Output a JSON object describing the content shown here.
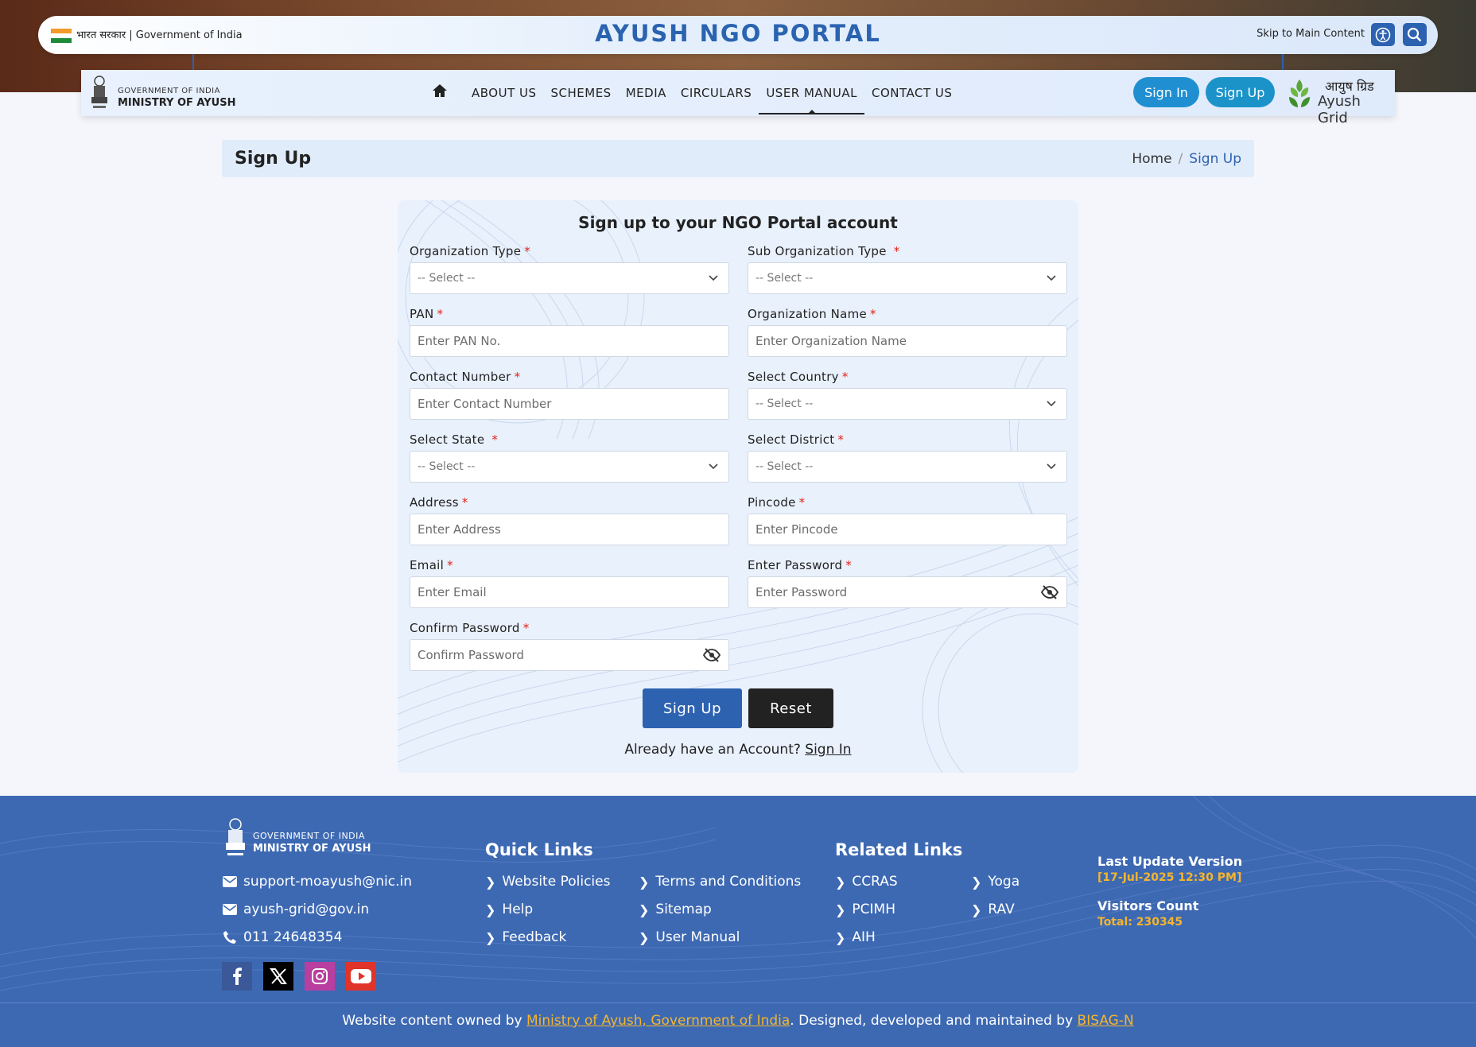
{
  "topbar": {
    "gov_label": "भारत सरकार | Government of India",
    "portal_title": "AYUSH NGO PORTAL",
    "skip_link": "Skip to Main Content",
    "accessibility_icon": "accessibility-icon",
    "search_icon": "search-icon"
  },
  "navbar": {
    "ministry_line1": "GOVERNMENT OF INDIA",
    "ministry_line2": "MINISTRY OF AYUSH",
    "home_icon": "home-icon",
    "menu": [
      {
        "label": "ABOUT US"
      },
      {
        "label": "SCHEMES"
      },
      {
        "label": "MEDIA"
      },
      {
        "label": "CIRCULARS"
      },
      {
        "label": "USER MANUAL",
        "active": true
      },
      {
        "label": "CONTACT US"
      }
    ],
    "signin_label": "Sign In",
    "signup_label": "Sign Up",
    "ayush_grid_hindi": "आयुष ग्रिड",
    "ayush_grid_english": "Ayush Grid"
  },
  "page": {
    "title": "Sign Up",
    "breadcrumb": {
      "home": "Home",
      "separator": "/",
      "current": "Sign Up"
    }
  },
  "form": {
    "heading": "Sign up to your NGO Portal account",
    "required_mark": "*",
    "fields": {
      "org_type": {
        "label": "Organization Type",
        "value": "-- Select --"
      },
      "sub_org_type": {
        "label": "Sub Organization Type",
        "value": "-- Select --"
      },
      "pan": {
        "label": "PAN",
        "placeholder": "Enter PAN No."
      },
      "org_name": {
        "label": "Organization Name",
        "placeholder": "Enter Organization Name"
      },
      "contact": {
        "label": "Contact Number",
        "placeholder": "Enter Contact Number"
      },
      "country": {
        "label": "Select Country",
        "value": "-- Select --"
      },
      "state": {
        "label": "Select State",
        "value": "-- Select --"
      },
      "district": {
        "label": "Select District",
        "value": "-- Select --"
      },
      "address": {
        "label": "Address",
        "placeholder": "Enter Address"
      },
      "pincode": {
        "label": "Pincode",
        "placeholder": "Enter Pincode"
      },
      "email": {
        "label": "Email",
        "placeholder": "Enter Email"
      },
      "password": {
        "label": "Enter Password",
        "placeholder": "Enter Password"
      },
      "confirm": {
        "label": "Confirm Password",
        "placeholder": "Confirm Password"
      }
    },
    "signup_button": "Sign Up",
    "reset_button": "Reset",
    "already_text": "Already have an Account?",
    "signin_link": "Sign In"
  },
  "footer": {
    "ministry_line1": "GOVERNMENT OF INDIA",
    "ministry_line2": "MINISTRY OF AYUSH",
    "contacts": [
      {
        "icon": "mail-icon",
        "text": "support-moayush@nic.in"
      },
      {
        "icon": "mail-icon",
        "text": "ayush-grid@gov.in"
      },
      {
        "icon": "phone-icon",
        "text": "011 24648354"
      }
    ],
    "social": [
      "facebook-icon",
      "x-icon",
      "instagram-icon",
      "youtube-icon"
    ],
    "quick_links_heading": "Quick Links",
    "quick_links": [
      "Website Policies",
      "Terms and Conditions",
      "Help",
      "Sitemap",
      "Feedback",
      "User Manual"
    ],
    "related_links_heading": "Related Links",
    "related_links": [
      "CCRAS",
      "Yoga",
      "PCIMH",
      "RAV",
      "AIH"
    ],
    "last_update_label": "Last Update Version",
    "last_update_value": "[17-Jul-2025 12:30 PM]",
    "visitors_label": "Visitors Count",
    "visitors_value": "Total: 230345",
    "bottom_prefix": "Website content owned by ",
    "bottom_owner": "Ministry of Ayush, Government of India",
    "bottom_middle": ". Designed, developed and maintained by ",
    "bottom_maintainer": "BISAG-N"
  },
  "colors": {
    "primary": "#2d62b1",
    "footer_bg": "#3d69b3",
    "accent": "#f5b52b",
    "required": "#e2231a",
    "signin_pill": "#1f8fd1",
    "signup_pill": "#1b93c9",
    "reset": "#222222"
  }
}
